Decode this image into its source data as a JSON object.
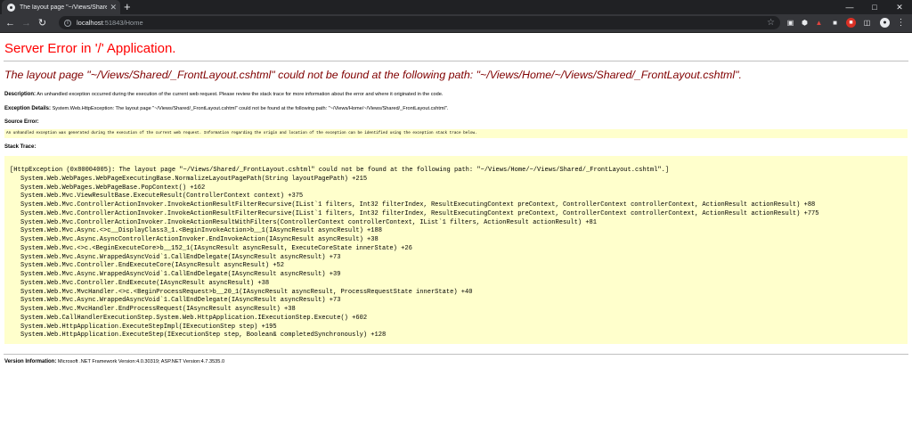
{
  "browser": {
    "tab_title": "The layout page \"~/Views/Shared/_FrontLayout.cshtml\" could not be found",
    "new_tab": "+",
    "url_host": "localhost",
    "url_rest": ":51843/Home"
  },
  "page": {
    "heading": "Server Error in '/' Application.",
    "error_title": "The layout page \"~/Views/Shared/_FrontLayout.cshtml\" could not be found at the following path: \"~/Views/Home/~/Views/Shared/_FrontLayout.cshtml\".",
    "description_label": "Description:",
    "description_text": " An unhandled exception occurred during the execution of the current web request. Please review the stack trace for more information about the error and where it originated in the code.",
    "exception_label": "Exception Details:",
    "exception_text": " System.Web.HttpException: The layout page \"~/Views/Shared/_FrontLayout.cshtml\" could not be found at the following path: \"~/Views/Home/~/Views/Shared/_FrontLayout.cshtml\".",
    "source_label": "Source Error:",
    "source_text": "An unhandled exception was generated during the execution of the current web request. Information regarding the origin and location of the exception can be identified using the exception stack trace below.",
    "stack_label": "Stack Trace:",
    "stack_first": "[HttpException (0x80004005): The layout page \"~/Views/Shared/_FrontLayout.cshtml\" could not be found at the following path: \"~/Views/Home/~/Views/Shared/_FrontLayout.cshtml\".]",
    "stack_frames": [
      "System.Web.WebPages.WebPageExecutingBase.NormalizeLayoutPagePath(String layoutPagePath) +215",
      "System.Web.WebPages.WebPageBase.PopContext() +162",
      "System.Web.Mvc.ViewResultBase.ExecuteResult(ControllerContext context) +375",
      "System.Web.Mvc.ControllerActionInvoker.InvokeActionResultFilterRecursive(IList`1 filters, Int32 filterIndex, ResultExecutingContext preContext, ControllerContext controllerContext, ActionResult actionResult) +88",
      "System.Web.Mvc.ControllerActionInvoker.InvokeActionResultFilterRecursive(IList`1 filters, Int32 filterIndex, ResultExecutingContext preContext, ControllerContext controllerContext, ActionResult actionResult) +775",
      "System.Web.Mvc.ControllerActionInvoker.InvokeActionResultWithFilters(ControllerContext controllerContext, IList`1 filters, ActionResult actionResult) +81",
      "System.Web.Mvc.Async.<>c__DisplayClass3_1.<BeginInvokeAction>b__1(IAsyncResult asyncResult) +188",
      "System.Web.Mvc.Async.AsyncControllerActionInvoker.EndInvokeAction(IAsyncResult asyncResult) +38",
      "System.Web.Mvc.<>c.<BeginExecuteCore>b__152_1(IAsyncResult asyncResult, ExecuteCoreState innerState) +26",
      "System.Web.Mvc.Async.WrappedAsyncVoid`1.CallEndDelegate(IAsyncResult asyncResult) +73",
      "System.Web.Mvc.Controller.EndExecuteCore(IAsyncResult asyncResult) +52",
      "System.Web.Mvc.Async.WrappedAsyncVoid`1.CallEndDelegate(IAsyncResult asyncResult) +39",
      "System.Web.Mvc.Controller.EndExecute(IAsyncResult asyncResult) +38",
      "System.Web.Mvc.MvcHandler.<>c.<BeginProcessRequest>b__20_1(IAsyncResult asyncResult, ProcessRequestState innerState) +40",
      "System.Web.Mvc.Async.WrappedAsyncVoid`1.CallEndDelegate(IAsyncResult asyncResult) +73",
      "System.Web.Mvc.MvcHandler.EndProcessRequest(IAsyncResult asyncResult) +38",
      "System.Web.CallHandlerExecutionStep.System.Web.HttpApplication.IExecutionStep.Execute() +602",
      "System.Web.HttpApplication.ExecuteStepImpl(IExecutionStep step) +195",
      "System.Web.HttpApplication.ExecuteStep(IExecutionStep step, Boolean& completedSynchronously) +128"
    ],
    "version_label": "Version Information:",
    "version_text": " Microsoft .NET Framework Version:4.0.30319; ASP.NET Version:4.7.3535.0"
  },
  "colors": {
    "heading": "#ff0000",
    "error_title": "#800000",
    "code_background": "#ffffcc",
    "browser_frame": "#202124",
    "browser_toolbar": "#35363a"
  },
  "icons": [
    "favicon-icon",
    "close-icon",
    "back-arrow-icon",
    "forward-arrow-icon",
    "reload-icon",
    "info-icon",
    "star-icon",
    "minimize-icon",
    "maximize-icon",
    "window-close-icon",
    "extension-icon",
    "profile-avatar-icon",
    "menu-icon"
  ]
}
